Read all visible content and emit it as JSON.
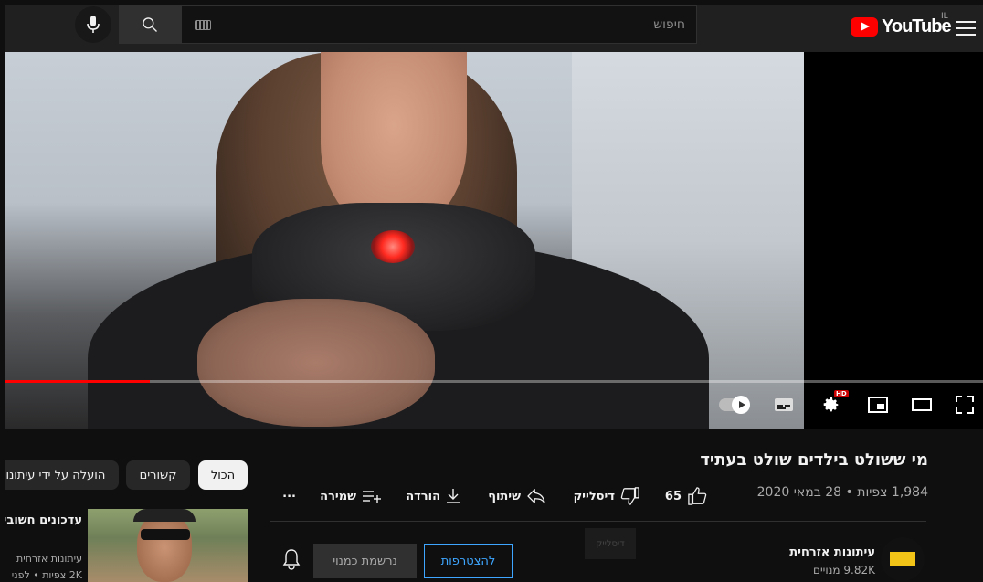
{
  "header": {
    "logo_text": "YouTube",
    "country_code": "IL",
    "search_placeholder": "חיפוש"
  },
  "player": {
    "progress_fraction": 0.148,
    "hd_badge": "HD"
  },
  "video": {
    "title": "מי ששולט בילדים שולט בעתיד",
    "views_date": "1,984 צפיות • 28 במאי 2020"
  },
  "actions": {
    "like_count": "65",
    "dislike_label": "דיסלייק",
    "share_label": "שיתוף",
    "download_label": "הורדה",
    "save_label": "שמירה",
    "more_label": "..."
  },
  "channel": {
    "name": "עיתונות אזרחית",
    "subscribers": "9.82K מנויים",
    "join_label": "להצטרפות",
    "subscribed_label": "נרשמת כמנוי",
    "ghost_dislike": "דיסלייק"
  },
  "chips": {
    "all": "הכול",
    "related": "קשורים",
    "uploaded_by": "הועלה על ידי עיתונות"
  },
  "suggestion": {
    "title": "עדכונים חשובים...הדרך",
    "channel": "עיתונות אזרחית",
    "views": "2K צפיות • לפני"
  },
  "colors": {
    "accent_red": "#ff0000",
    "link_blue": "#3ea6ff",
    "background": "#0f0f0f"
  }
}
